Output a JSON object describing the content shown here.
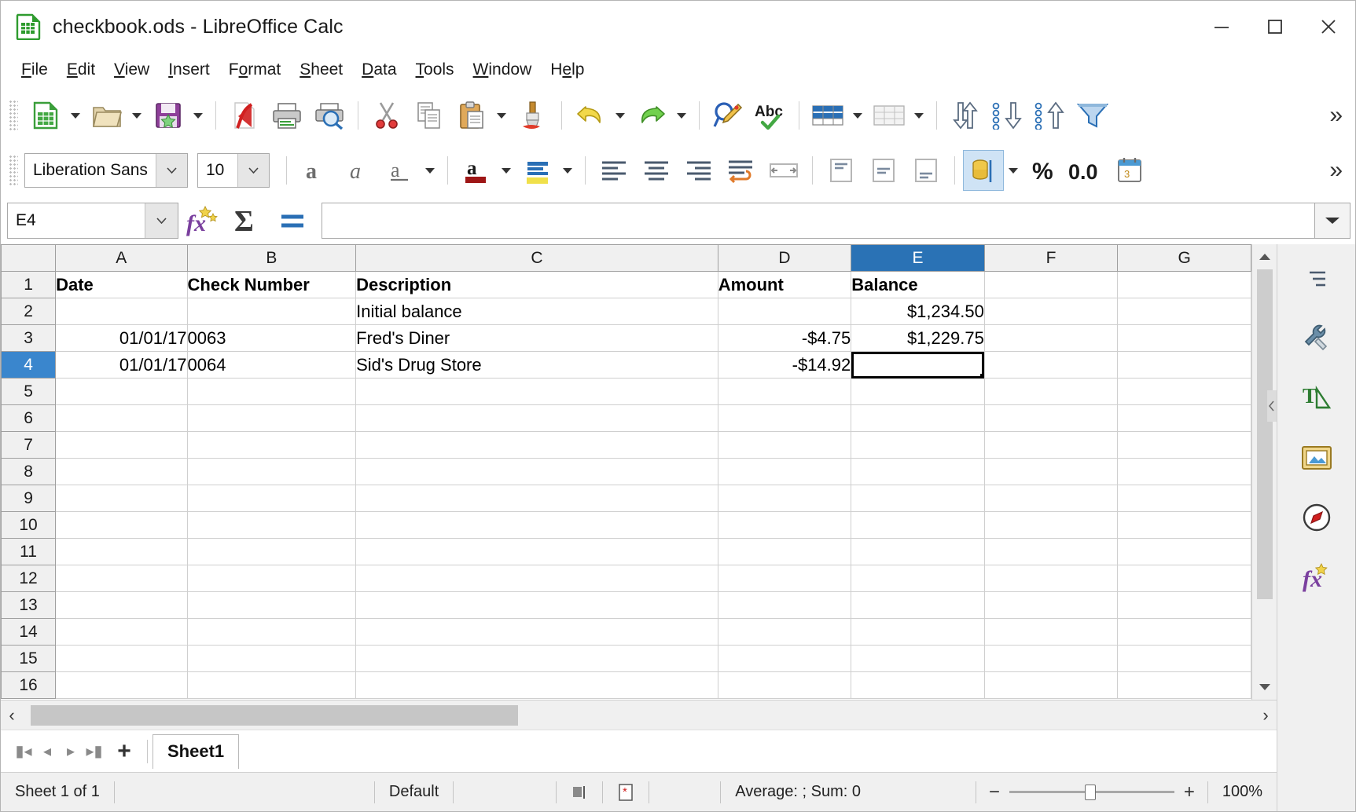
{
  "window": {
    "title": "checkbook.ods - LibreOffice Calc",
    "minimize_label": "minimize-icon",
    "maximize_label": "maximize-icon",
    "close_label": "close-icon"
  },
  "menubar": {
    "items": [
      {
        "label": "File",
        "mnemonic": "F",
        "rest": "ile"
      },
      {
        "label": "Edit",
        "mnemonic": "E",
        "rest": "dit"
      },
      {
        "label": "View",
        "pre": "",
        "mnemonic": "V",
        "rest": "iew"
      },
      {
        "label": "Insert",
        "mnemonic": "I",
        "rest": "nsert"
      },
      {
        "label": "Format",
        "pre": "F",
        "mnemonic": "o",
        "rest": "rmat"
      },
      {
        "label": "Sheet",
        "mnemonic": "S",
        "rest": "heet"
      },
      {
        "label": "Data",
        "mnemonic": "D",
        "rest": "ata"
      },
      {
        "label": "Tools",
        "mnemonic": "T",
        "rest": "ools"
      },
      {
        "label": "Window",
        "mnemonic": "W",
        "rest": "indow"
      },
      {
        "label": "Help",
        "pre": "H",
        "mnemonic": "e",
        "rest": "lp"
      }
    ]
  },
  "standard_toolbar": {
    "overflow_label": "»",
    "buttons": [
      "new-document-icon",
      "open-file-icon",
      "save-icon",
      "export-pdf-icon",
      "print-icon",
      "print-preview-icon",
      "cut-icon",
      "copy-icon",
      "paste-icon",
      "clone-formatting-icon",
      "undo-icon",
      "redo-icon",
      "find-replace-icon",
      "spelling-icon",
      "row-icon",
      "column-icon",
      "sort-icon",
      "sort-ascending-icon",
      "sort-descending-icon",
      "autofilter-icon"
    ]
  },
  "format_toolbar": {
    "font_name": "Liberation Sans",
    "font_size": "10",
    "overflow_label": "»",
    "buttons": [
      "bold-icon",
      "italic-icon",
      "underline-icon",
      "font-color-icon",
      "highlight-color-icon",
      "align-left-icon",
      "align-center-icon",
      "align-right-icon",
      "justified-icon",
      "wrap-text-icon",
      "merge-cells-icon",
      "align-top-icon",
      "align-center-vertical-icon",
      "align-bottom-icon",
      "currency-format-icon",
      "percent-format-icon",
      "number-format-icon",
      "date-format-icon"
    ]
  },
  "formula_bar": {
    "name_box": "E4",
    "formula_value": "",
    "formula_placeholder": "",
    "function_wizard": "function-wizard-icon",
    "sum": "sum-icon",
    "formula": "formula-icon",
    "expand": "expand-formula-bar-icon"
  },
  "spreadsheet": {
    "column_headers": [
      "A",
      "B",
      "C",
      "D",
      "E",
      "F",
      "G"
    ],
    "selected_column": "E",
    "selected_row": 4,
    "active_cell": "E4",
    "row_numbers": [
      1,
      2,
      3,
      4,
      5,
      6,
      7,
      8,
      9,
      10,
      11,
      12,
      13,
      14,
      15,
      16
    ],
    "rows": [
      {
        "num": 1,
        "cells": [
          "Date",
          "Check Number",
          "Description",
          "Amount",
          "Balance",
          "",
          ""
        ],
        "bold": true,
        "align": [
          "left",
          "left",
          "left",
          "left",
          "left",
          "left",
          "left"
        ]
      },
      {
        "num": 2,
        "cells": [
          "",
          "",
          "Initial balance",
          "",
          "$1,234.50",
          "",
          ""
        ],
        "bold": false,
        "align": [
          "left",
          "left",
          "left",
          "right",
          "right",
          "left",
          "left"
        ]
      },
      {
        "num": 3,
        "cells": [
          "01/01/17",
          "0063",
          "Fred's Diner",
          "-$4.75",
          "$1,229.75",
          "",
          ""
        ],
        "bold": false,
        "align": [
          "right",
          "left",
          "left",
          "right",
          "right",
          "left",
          "left"
        ]
      },
      {
        "num": 4,
        "cells": [
          "01/01/17",
          "0064",
          "Sid's Drug Store",
          "-$14.92",
          "",
          "",
          ""
        ],
        "bold": false,
        "align": [
          "right",
          "left",
          "left",
          "right",
          "right",
          "left",
          "left"
        ]
      },
      {
        "num": 5,
        "cells": [
          "",
          "",
          "",
          "",
          "",
          "",
          ""
        ],
        "bold": false,
        "align": [
          "left",
          "left",
          "left",
          "right",
          "right",
          "left",
          "left"
        ]
      },
      {
        "num": 6,
        "cells": [
          "",
          "",
          "",
          "",
          "",
          "",
          ""
        ],
        "bold": false,
        "align": [
          "left",
          "left",
          "left",
          "right",
          "right",
          "left",
          "left"
        ]
      },
      {
        "num": 7,
        "cells": [
          "",
          "",
          "",
          "",
          "",
          "",
          ""
        ],
        "bold": false,
        "align": [
          "left",
          "left",
          "left",
          "right",
          "right",
          "left",
          "left"
        ]
      },
      {
        "num": 8,
        "cells": [
          "",
          "",
          "",
          "",
          "",
          "",
          ""
        ],
        "bold": false,
        "align": [
          "left",
          "left",
          "left",
          "right",
          "right",
          "left",
          "left"
        ]
      },
      {
        "num": 9,
        "cells": [
          "",
          "",
          "",
          "",
          "",
          "",
          ""
        ],
        "bold": false,
        "align": [
          "left",
          "left",
          "left",
          "right",
          "right",
          "left",
          "left"
        ]
      },
      {
        "num": 10,
        "cells": [
          "",
          "",
          "",
          "",
          "",
          "",
          ""
        ],
        "bold": false,
        "align": [
          "left",
          "left",
          "left",
          "right",
          "right",
          "left",
          "left"
        ]
      },
      {
        "num": 11,
        "cells": [
          "",
          "",
          "",
          "",
          "",
          "",
          ""
        ],
        "bold": false,
        "align": [
          "left",
          "left",
          "left",
          "right",
          "right",
          "left",
          "left"
        ]
      },
      {
        "num": 12,
        "cells": [
          "",
          "",
          "",
          "",
          "",
          "",
          ""
        ],
        "bold": false,
        "align": [
          "left",
          "left",
          "left",
          "right",
          "right",
          "left",
          "left"
        ]
      },
      {
        "num": 13,
        "cells": [
          "",
          "",
          "",
          "",
          "",
          "",
          ""
        ],
        "bold": false,
        "align": [
          "left",
          "left",
          "left",
          "right",
          "right",
          "left",
          "left"
        ]
      },
      {
        "num": 14,
        "cells": [
          "",
          "",
          "",
          "",
          "",
          "",
          ""
        ],
        "bold": false,
        "align": [
          "left",
          "left",
          "left",
          "right",
          "right",
          "left",
          "left"
        ]
      },
      {
        "num": 15,
        "cells": [
          "",
          "",
          "",
          "",
          "",
          "",
          ""
        ],
        "bold": false,
        "align": [
          "left",
          "left",
          "left",
          "right",
          "right",
          "left",
          "left"
        ]
      },
      {
        "num": 16,
        "cells": [
          "",
          "",
          "",
          "",
          "",
          "",
          ""
        ],
        "bold": false,
        "align": [
          "left",
          "left",
          "left",
          "right",
          "right",
          "left",
          "left"
        ]
      }
    ]
  },
  "sheet_tabs": {
    "first_label": "first-sheet-icon",
    "prev_label": "previous-sheet-icon",
    "next_label": "next-sheet-icon",
    "last_label": "last-sheet-icon",
    "add_label": "+",
    "tabs": [
      {
        "label": "Sheet1",
        "active": true
      }
    ]
  },
  "status_bar": {
    "sheet_count": "Sheet 1 of 1",
    "page_style": "Default",
    "selection_mode_icon": "selection-mode-icon",
    "modified_icon": "document-modified-icon",
    "average_sum": "Average: ; Sum: 0",
    "zoom_out": "−",
    "zoom_in": "+",
    "zoom_level": "100%"
  },
  "sidebar": {
    "items": [
      {
        "name": "sidebar-settings-icon",
        "label": "Sidebar Settings"
      },
      {
        "name": "properties-icon",
        "label": "Properties"
      },
      {
        "name": "styles-icon",
        "label": "Styles"
      },
      {
        "name": "gallery-icon",
        "label": "Gallery"
      },
      {
        "name": "navigator-icon",
        "label": "Navigator"
      },
      {
        "name": "functions-icon",
        "label": "Functions"
      }
    ]
  },
  "colors": {
    "selected_header": "#2a72b5",
    "selected_rowhead": "#3a86cd",
    "accent": "#2a72b5"
  }
}
